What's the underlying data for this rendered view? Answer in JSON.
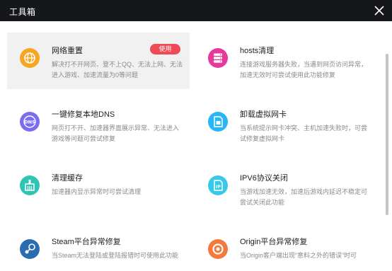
{
  "window": {
    "title": "工具箱"
  },
  "tools": [
    {
      "name": "网络重置",
      "desc": "解决打不开网页、登不上QQ、无法上网、无法进入游戏、加速流量为0等问题",
      "icon": "globe-icon",
      "color": "#f5a623",
      "action": "使用"
    },
    {
      "name": "hosts清理",
      "desc": "连接游戏服务器失败，当遇到网页访问异常，加速无效时可尝试使用此功能修复",
      "icon": "server-icon",
      "color": "#e6399b"
    },
    {
      "name": "一键修复本地DNS",
      "desc": "网页打不开、加速器界面展示异常、无法进入游戏等问题可尝试修复",
      "icon": "dns-icon",
      "color": "#7b6cf6"
    },
    {
      "name": "卸载虚拟网卡",
      "desc": "当系统提示网卡冲突、主机加速失败时，可尝试修复虚拟网卡",
      "icon": "sim-card-icon",
      "color": "#29b6f6"
    },
    {
      "name": "清理缓存",
      "desc": "加速器内显示异常时可尝试清理",
      "icon": "broom-icon",
      "color": "#2ec4b6"
    },
    {
      "name": "IPV6协议关闭",
      "desc": "当游戏加速无效，加速后游戏内延迟不稳定可尝试关闭此功能",
      "icon": "ip-card-icon",
      "color": "#38c8e8"
    },
    {
      "name": "Steam平台异常修复",
      "desc": "当Steam无法登陆或登陆报错时可使用此功能",
      "icon": "steam-icon",
      "color": "#2b6cb0"
    },
    {
      "name": "Origin平台异常修复",
      "desc": "当Origin客户端出现“意料之外的错误”时可",
      "icon": "origin-icon",
      "color": "#f37a3a"
    }
  ]
}
